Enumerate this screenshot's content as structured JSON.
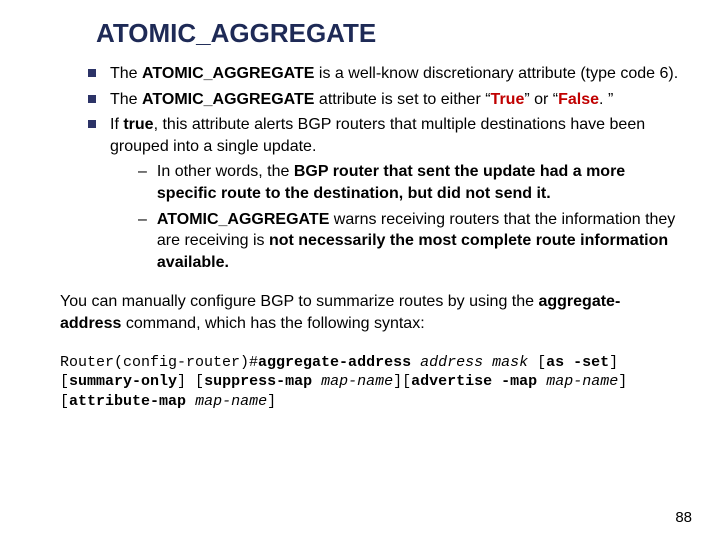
{
  "title": "ATOMIC_AGGREGATE",
  "bullets": {
    "b1": {
      "pre": "The ",
      "bold1": "ATOMIC_AGGREGATE",
      "post": " is a well-know discretionary attribute (type code 6)."
    },
    "b2": {
      "pre": "The ",
      "bold1": "ATOMIC_AGGREGATE",
      "mid1": " attribute is set to either “",
      "true": "True",
      "mid2": "” or “",
      "false": "False",
      "post": ". ”"
    },
    "b3": {
      "pre": "If ",
      "bold1": "true",
      "post": ", this attribute alerts BGP routers that multiple destinations have been grouped into a single update."
    },
    "b3a": {
      "pre": "In other words, the ",
      "bold1": "BGP router that sent the update had a more specific route to the destination, but did not send it."
    },
    "b3b": {
      "bold1": "ATOMIC_AGGREGATE",
      "mid": " warns receiving routers that the information they are receiving is ",
      "bold2": "not necessarily the most complete route information available."
    }
  },
  "para": {
    "pre": "You can manually configure BGP to summarize routes by using the ",
    "bold": "aggregate-address",
    "post": " command, which has the following syntax:"
  },
  "code": {
    "prompt": "Router(config-router)#",
    "cmd": "aggregate-address",
    "sp1": " ",
    "arg_addr": "address",
    "sp2": " ",
    "arg_mask": "mask",
    "sp3": " [",
    "as_set": "as -set",
    "br1": "][",
    "summary": "summary-only",
    "br2": "] [",
    "suppress": "suppress-map",
    "sp4": " ",
    "mapname1": "map-name",
    "br3": "][",
    "advmap": "advertise -map",
    "sp5": " ",
    "mapname2": "map-name",
    "br4": "] [",
    "attrmap": "attribute-map",
    "sp6": " ",
    "mapname3": "map-name",
    "br5": "]"
  },
  "pagenum": "88"
}
